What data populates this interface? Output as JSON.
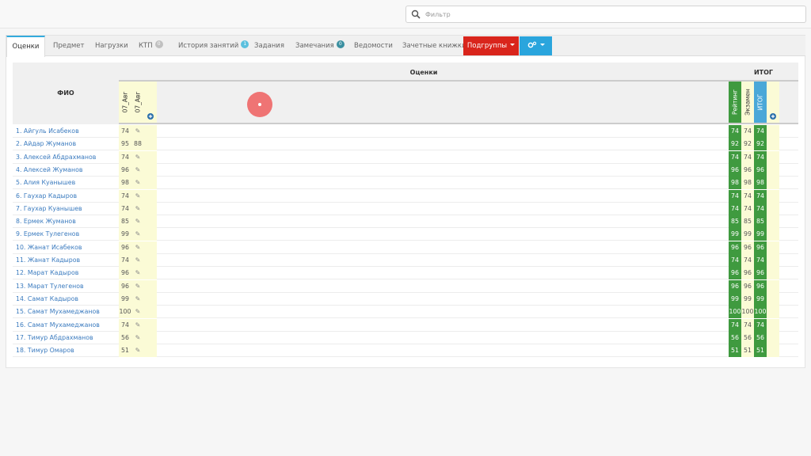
{
  "search": {
    "placeholder": "Фильтр"
  },
  "tabs": [
    {
      "label": "Оценки",
      "active": true
    },
    {
      "label": "Предмет"
    },
    {
      "label": "Нагрузки"
    },
    {
      "label": "КТП",
      "badge": "0",
      "badge_color": "#c0c0c0"
    },
    {
      "label": "История занятий",
      "badge": "1",
      "badge_color": "#5bc0de"
    },
    {
      "label": "Задания"
    },
    {
      "label": "Замечания",
      "badge": "0",
      "badge_color": "#3a8fa0"
    },
    {
      "label": "Ведомости"
    },
    {
      "label": "Зачетные книжки"
    }
  ],
  "subgroups_button": "Подгруппы",
  "table": {
    "fio_header": "ФИО",
    "grades_header": "Оценки",
    "total_header": "ИТОГ",
    "date_cols": [
      "07_Авг",
      "07_Авг"
    ],
    "total_cols": [
      "Рейтинг",
      "Экзамен",
      "ИТОГ"
    ],
    "rows": [
      {
        "name": "1. Айгуль Исабеков",
        "g1": "74",
        "g2": "",
        "total": "74"
      },
      {
        "name": "2. Айдар Жуманов",
        "g1": "95",
        "g2": "88",
        "total": "92"
      },
      {
        "name": "3. Алексей Абдрахманов",
        "g1": "74",
        "g2": "",
        "total": "74"
      },
      {
        "name": "4. Алексей Жуманов",
        "g1": "96",
        "g2": "",
        "total": "96"
      },
      {
        "name": "5. Алия Куанышев",
        "g1": "98",
        "g2": "",
        "total": "98"
      },
      {
        "name": "6. Гаухар Кадыров",
        "g1": "74",
        "g2": "",
        "total": "74"
      },
      {
        "name": "7. Гаухар Куанышев",
        "g1": "74",
        "g2": "",
        "total": "74"
      },
      {
        "name": "8. Ермек Жуманов",
        "g1": "85",
        "g2": "",
        "total": "85"
      },
      {
        "name": "9. Ермек Тулегенов",
        "g1": "99",
        "g2": "",
        "total": "99"
      },
      {
        "name": "10. Жанат Исабеков",
        "g1": "96",
        "g2": "",
        "total": "96"
      },
      {
        "name": "11. Жанат Кадыров",
        "g1": "74",
        "g2": "",
        "total": "74"
      },
      {
        "name": "12. Марат Кадыров",
        "g1": "96",
        "g2": "",
        "total": "96"
      },
      {
        "name": "13. Марат Тулегенов",
        "g1": "96",
        "g2": "",
        "total": "96"
      },
      {
        "name": "14. Самат Кадыров",
        "g1": "99",
        "g2": "",
        "total": "99"
      },
      {
        "name": "15. Самат Мухамеджанов",
        "g1": "100",
        "g2": "",
        "total": "100"
      },
      {
        "name": "16. Самат Мухамеджанов",
        "g1": "74",
        "g2": "",
        "total": "74"
      },
      {
        "name": "17. Тимур Абдрахманов",
        "g1": "56",
        "g2": "",
        "total": "56"
      },
      {
        "name": "18. Тимур Омаров",
        "g1": "51",
        "g2": "",
        "total": "51"
      }
    ]
  },
  "colors": {
    "accent": "#33aadd",
    "red_button": "#d9251c",
    "blue_button": "#2aa5dd",
    "green_cell": "#3f9a3f",
    "yellow_cell": "#fbfbd6",
    "link": "#3b7bbf"
  }
}
